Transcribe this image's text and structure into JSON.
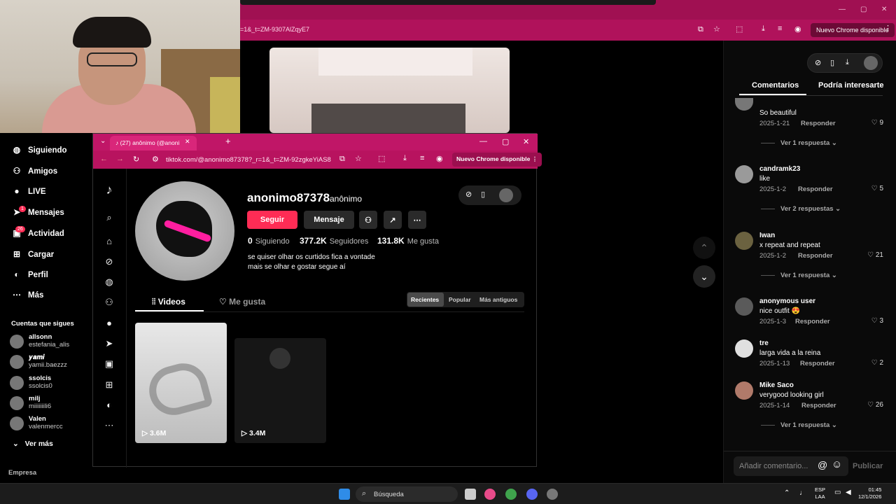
{
  "bg_window": {
    "url_fragment": "=1&_t=ZM-9307AlZqyE7",
    "update_chip": "Nuevo Chrome disponible"
  },
  "front_window": {
    "tab_title": "(27) anônimo (@anoni",
    "url": "tiktok.com/@anonimo87378?_r=1&_t=ZM-92zgkeYiAS8",
    "update_chip": "Nuevo Chrome disponible"
  },
  "profile": {
    "username": "anonimo87378",
    "display_name": "anônimo",
    "follow_label": "Seguir",
    "message_label": "Mensaje",
    "following_count": "0",
    "following_label": "Siguiendo",
    "followers_count": "377.2K",
    "followers_label": "Seguidores",
    "likes_count": "131.8K",
    "likes_label": "Me gusta",
    "bio_line1": "se quiser olhar os curtidos fica a vontade",
    "bio_line2": "mais se olhar e gostar segue aí",
    "tabs": [
      {
        "label": "Videos"
      },
      {
        "label": "Me gusta"
      }
    ],
    "sort": {
      "recent": "Recientes",
      "popular": "Popular",
      "oldest": "Más antiguos"
    },
    "videos": [
      {
        "views": "3.6M"
      },
      {
        "views": "3.4M"
      }
    ]
  },
  "sidebar": {
    "nav": [
      {
        "label": "Siguiendo",
        "icon": "following-icon"
      },
      {
        "label": "Amigos",
        "icon": "friends-icon"
      },
      {
        "label": "LIVE",
        "icon": "live-icon"
      },
      {
        "label": "Mensajes",
        "icon": "messages-icon",
        "badge": "1"
      },
      {
        "label": "Actividad",
        "icon": "activity-icon",
        "badge": "26"
      },
      {
        "label": "Cargar",
        "icon": "upload-icon"
      },
      {
        "label": "Perfil",
        "icon": "profile-icon"
      },
      {
        "label": "Más",
        "icon": "more-icon"
      }
    ],
    "following_header": "Cuentas que sigues",
    "following": [
      {
        "name": "allsonn",
        "handle": "estefania_alis"
      },
      {
        "name": "𝒚𝒂𝒎𝒊",
        "handle": "yamii.baezzz"
      },
      {
        "name": "ssolcis",
        "handle": "ssolcis0"
      },
      {
        "name": "milj",
        "handle": "miiiiiiili6"
      },
      {
        "name": "Valen",
        "handle": "valenmercc"
      }
    ],
    "see_more": "Ver más",
    "company": "Empresa"
  },
  "comments_panel": {
    "tabs": [
      "Comentarios",
      "Podría interesarte"
    ],
    "reply_label": "Responder",
    "comments": [
      {
        "user": "",
        "text": "So beautiful",
        "date": "2025-1-21",
        "likes": "9",
        "more": "Ver 1 respuesta"
      },
      {
        "user": "candramk23",
        "text": "like",
        "date": "2025-1-2",
        "likes": "5",
        "more": "Ver 2 respuestas"
      },
      {
        "user": "Iwan",
        "text": "x repeat and repeat",
        "date": "2025-1-2",
        "likes": "21",
        "more": "Ver 1 respuesta"
      },
      {
        "user": "anonymous user",
        "text": "nice outfit 😍",
        "date": "2025-1-3",
        "likes": "3",
        "more": ""
      },
      {
        "user": "tre",
        "text": "larga vida a la reina",
        "date": "2025-1-13",
        "likes": "2",
        "more": ""
      },
      {
        "user": "Mike Saco",
        "text": "verygood looking girl",
        "date": "2025-1-14",
        "likes": "26",
        "more": "Ver 1 respuesta"
      }
    ],
    "input_placeholder": "Añadir comentario...",
    "publish": "Publicar"
  },
  "taskbar": {
    "search": "Búsqueda",
    "lang1": "ESP",
    "lang2": "LAA",
    "time": "01:45",
    "date": "12/1/2026"
  },
  "colors": {
    "tiktok_red": "#fe2c55",
    "chrome_pink": "#c01667"
  }
}
